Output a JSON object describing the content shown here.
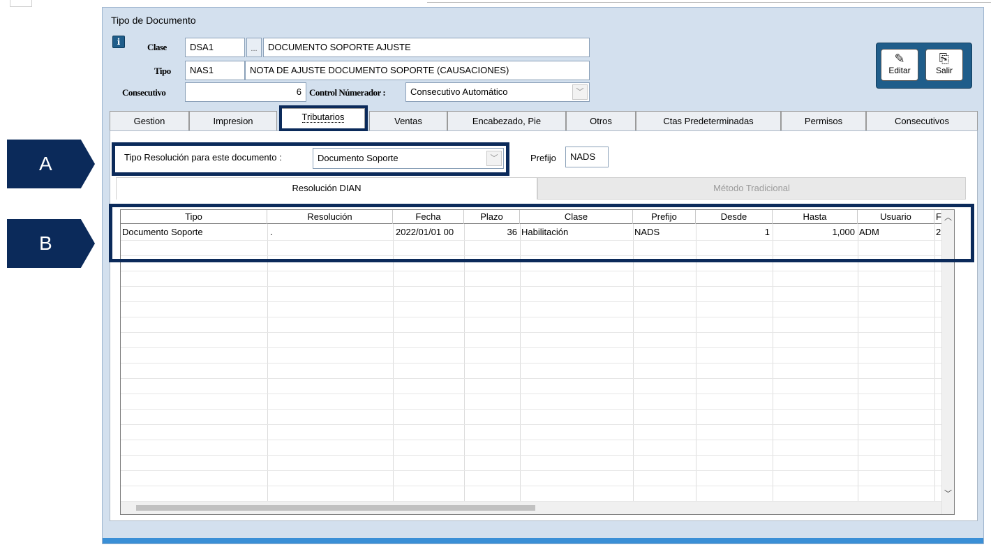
{
  "window_title": "Tipo de Documento",
  "info_icon": "i",
  "header": {
    "clase_label": "Clase",
    "clase_code": "DSA1",
    "ellipsis": "...",
    "clase_desc": "DOCUMENTO SOPORTE AJUSTE",
    "tipo_label": "Tipo",
    "tipo_code": "NAS1",
    "tipo_desc": "NOTA DE AJUSTE DOCUMENTO SOPORTE (CAUSACIONES)",
    "consecutivo_label": "Consecutivo",
    "consecutivo_value": "6",
    "control_label": "Control Númerador :",
    "control_value": "Consecutivo Automático"
  },
  "toolbar": {
    "editar": "Editar",
    "salir": "Salir"
  },
  "tabs": [
    "Gestion",
    "Impresion",
    "Tributarios",
    "Ventas",
    "Encabezado, Pie",
    "Otros",
    "Ctas Predeterminadas",
    "Permisos",
    "Consecutivos"
  ],
  "active_tab": "Tributarios",
  "resolution": {
    "label": "Tipo Resolución para este documento  :",
    "value": "Documento Soporte",
    "prefijo_label": "Prefijo",
    "prefijo_value": "NADS"
  },
  "callouts": {
    "a": "A",
    "b": "B"
  },
  "subtabs": {
    "resolucion": "Resolución DIAN",
    "metodo": "Método Tradicional"
  },
  "grid": {
    "columns": [
      "Tipo",
      "Resolución",
      "Fecha",
      "Plazo",
      "Clase",
      "Prefijo",
      "Desde",
      "Hasta",
      "Usuario",
      "Fe"
    ],
    "rows": [
      [
        "Documento Soporte",
        ".",
        "2022/01/01 00",
        "36",
        "Habilitación",
        "NADS",
        "1",
        "1,000",
        "ADM",
        "2"
      ]
    ]
  },
  "colors": {
    "accent": "#0b2a5a",
    "window_bg": "#d3e0ee",
    "toolbar_bg": "#1f5d8a"
  }
}
